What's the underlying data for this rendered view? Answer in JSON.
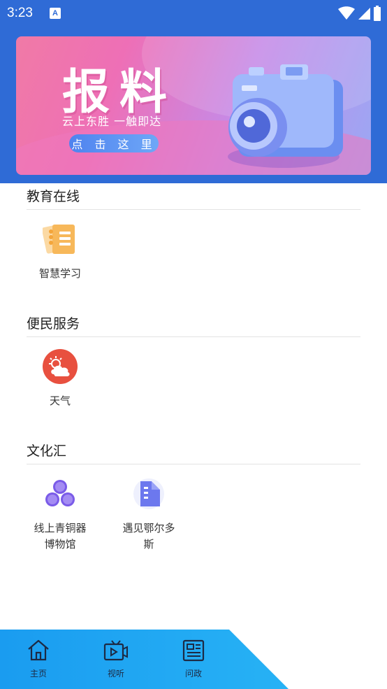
{
  "status": {
    "time": "3:23",
    "notification_icon": "A"
  },
  "banner": {
    "title": "报料",
    "subtitle": "云上东胜  一触即达",
    "button_label": "点 击 这 里"
  },
  "sections": [
    {
      "title": "教育在线",
      "items": [
        {
          "label": "智慧学习",
          "icon": "study-notebook-icon"
        }
      ]
    },
    {
      "title": "便民服务",
      "items": [
        {
          "label": "天气",
          "icon": "weather-icon"
        }
      ]
    },
    {
      "title": "文化汇",
      "items": [
        {
          "label": "线上青铜器博物馆",
          "icon": "museum-circles-icon"
        },
        {
          "label": "遇见鄂尔多斯",
          "icon": "document-icon"
        }
      ]
    }
  ],
  "bottom_nav": [
    {
      "label": "主页",
      "icon": "home-icon"
    },
    {
      "label": "视听",
      "icon": "tv-play-icon"
    },
    {
      "label": "问政",
      "icon": "newspaper-icon"
    }
  ],
  "colors": {
    "header_blue": "#2f6bd6",
    "nav_blue": "#19a3f2",
    "weather_red": "#e8503f",
    "purple": "#7a5be8",
    "study_orange": "#f7b85a"
  }
}
